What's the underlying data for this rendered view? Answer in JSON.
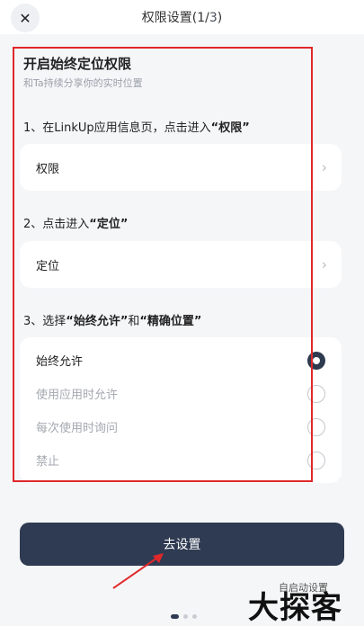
{
  "header": {
    "close_icon": "close-icon",
    "title_prefix": "权限设置(1/",
    "title_step": "3",
    "title_suffix": ")"
  },
  "intro": {
    "title": "开启始终定位权限",
    "subtitle": "和Ta持续分享你的实时位置"
  },
  "steps": [
    {
      "prefix": "1、在LinkUp应用信息页，点击进入",
      "highlight": "“权限”",
      "row_label": "权限"
    },
    {
      "prefix": "2、点击进入",
      "highlight": "“定位”",
      "row_label": "定位"
    },
    {
      "prefix": "3、选择",
      "highlight1": "“始终允许”",
      "middle": "和",
      "highlight2": "“精确位置”"
    }
  ],
  "options": [
    "始终允许",
    "使用应用时允许",
    "每次使用时询问",
    "禁止"
  ],
  "selected_option": "始终允许",
  "go_button": "去设置",
  "auto_note": "自启动设置",
  "watermark": "大探客",
  "page_indicator": {
    "total": 3,
    "current": 1
  },
  "colors": {
    "accent": "#2f3b52",
    "annotation": "#e0282a"
  }
}
